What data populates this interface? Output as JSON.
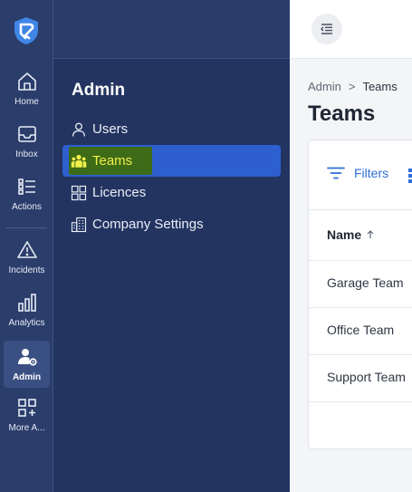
{
  "rail": {
    "items": [
      {
        "label": "Home",
        "icon": "home-icon"
      },
      {
        "label": "Inbox",
        "icon": "inbox-icon"
      },
      {
        "label": "Actions",
        "icon": "list-icon"
      },
      {
        "label": "Incidents",
        "icon": "warning-icon"
      },
      {
        "label": "Analytics",
        "icon": "bar-chart-icon"
      },
      {
        "label": "Admin",
        "icon": "user-settings-icon",
        "active": true
      },
      {
        "label": "More A...",
        "icon": "apps-add-icon"
      }
    ]
  },
  "side_panel": {
    "title": "Admin",
    "items": [
      {
        "label": "Users",
        "icon": "user-icon"
      },
      {
        "label": "Teams",
        "icon": "team-icon",
        "active": true
      },
      {
        "label": "Licences",
        "icon": "grid-icon"
      },
      {
        "label": "Company Settings",
        "icon": "building-icon"
      }
    ]
  },
  "breadcrumb": {
    "parent": "Admin",
    "separator": ">",
    "current": "Teams"
  },
  "page": {
    "title": "Teams"
  },
  "table": {
    "filters_label": "Filters",
    "columns": [
      {
        "label": "Name",
        "sort": "ascending"
      }
    ],
    "rows": [
      {
        "name": "Garage Team"
      },
      {
        "name": "Office Team"
      },
      {
        "name": "Support Team"
      }
    ]
  },
  "colors": {
    "rail_bg": "#2b3d6b",
    "panel_bg": "#233461",
    "active_item": "#2d5fcf",
    "highlight": "#3d6b17",
    "highlight_text": "#f3f04a",
    "accent": "#2d6fd8"
  }
}
